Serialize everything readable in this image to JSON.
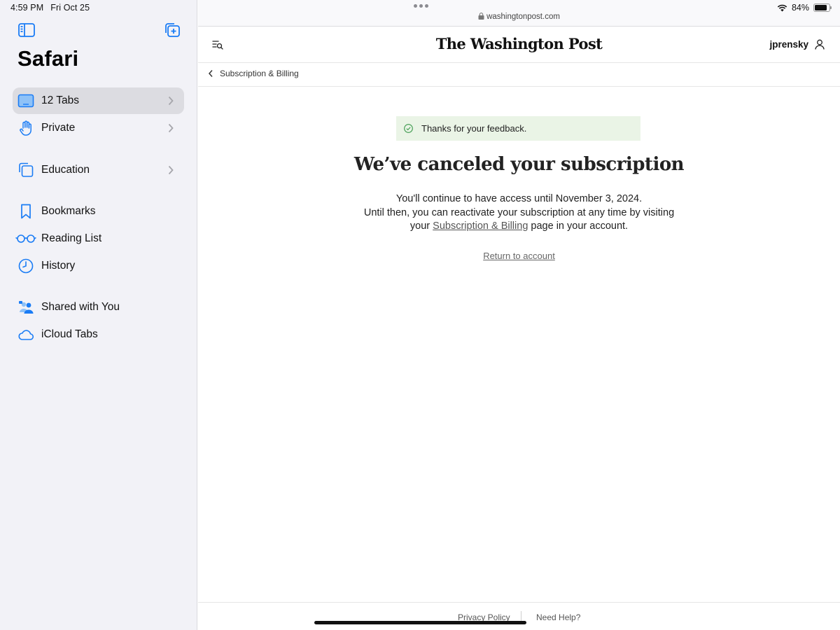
{
  "status_bar": {
    "time": "4:59 PM",
    "date": "Fri Oct 25",
    "battery": "84%",
    "battery_level": 0.84
  },
  "browser": {
    "url": "washingtonpost.com"
  },
  "sidebar": {
    "title": "Safari",
    "groups": [
      {
        "label": "12 Tabs",
        "icon": "tabs-icon",
        "selected": true
      },
      {
        "label": "Private",
        "icon": "hand-icon"
      },
      {
        "label": "Education",
        "icon": "tab-group-icon"
      }
    ],
    "library": [
      {
        "label": "Bookmarks",
        "icon": "bookmark-icon"
      },
      {
        "label": "Reading List",
        "icon": "glasses-icon"
      },
      {
        "label": "History",
        "icon": "clock-icon"
      }
    ],
    "shared": [
      {
        "label": "Shared with You",
        "icon": "people-icon"
      },
      {
        "label": "iCloud Tabs",
        "icon": "cloud-icon"
      }
    ]
  },
  "site": {
    "logo": "The Washington Post",
    "username": "jprensky",
    "breadcrumb": "Subscription & Billing"
  },
  "content": {
    "toast": "Thanks for your feedback.",
    "headline": "We’ve canceled your subscription",
    "line1": "You'll continue to have access until November 3, 2024.",
    "line2": "Until then, you can reactivate your subscription at any time by visiting",
    "line3_prefix": "your",
    "line3_link": "Subscription & Billing",
    "line3_suffix": "page in your account.",
    "return_link": "Return to account"
  },
  "footer": {
    "privacy": "Privacy Policy",
    "help": "Need Help?"
  },
  "colors": {
    "accent": "#1a7cf5",
    "sidebar_bg": "#f2f2f7",
    "toast_bg": "#eaf4e6",
    "toast_icon": "#3e9a4e"
  }
}
